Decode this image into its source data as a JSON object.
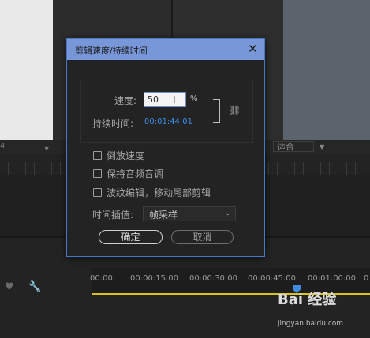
{
  "dialog": {
    "title": "剪辑速度/持续时间",
    "speed_label": "速度:",
    "speed_value": "50",
    "percent_sign": "%",
    "duration_label": "持续时间:",
    "duration_value": "00:01:44:01",
    "reverse_label": "倒放速度",
    "maintain_pitch_label": "保持音频音调",
    "ripple_label": "波纹编辑，移动尾部剪辑",
    "interpolation_label": "时间插值:",
    "interpolation_value": "帧采样",
    "ok_label": "确定",
    "cancel_label": "取消",
    "close_glyph": "✕",
    "link_glyph": "⛓"
  },
  "program_monitor": {
    "fit_value": "适合"
  },
  "source_monitor": {
    "left_number": "4"
  },
  "timeline": {
    "times": [
      "00:00",
      "00:00:15:00",
      "00:00:30:00",
      "00:00:45:00",
      "00:01:00:00",
      "0"
    ]
  },
  "watermark": {
    "brand": "Bai 经验",
    "url": "jingyan.baidu.com"
  },
  "colors": {
    "title_bar": "#7897d8",
    "dialog_border": "#4a78c8",
    "duration_text": "#3b8ee8",
    "playhead": "#3e8ce0",
    "work_area": "#d8c31e"
  }
}
